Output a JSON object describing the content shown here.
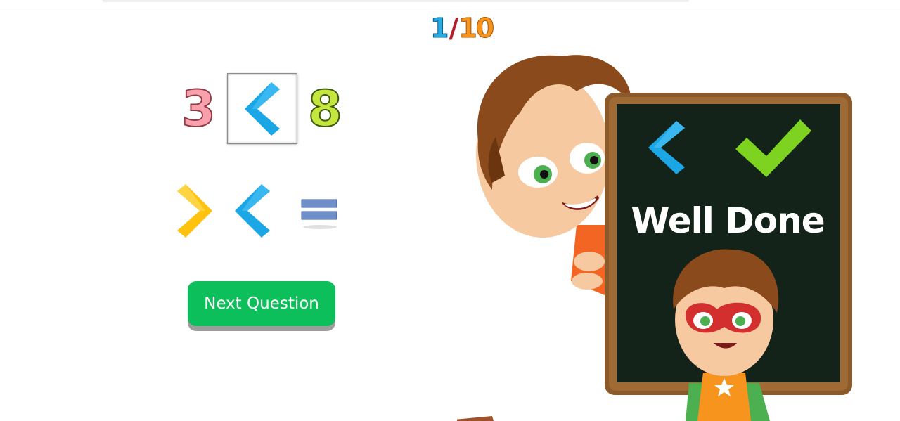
{
  "progress": {
    "current": "1",
    "separator": "/",
    "total": "10"
  },
  "question": {
    "left_number": "3",
    "right_number": "8",
    "placed_symbol": "less-than"
  },
  "choices": [
    {
      "id": "greater-than",
      "color": "#ffc20e"
    },
    {
      "id": "less-than",
      "color": "#1ba6e6"
    },
    {
      "id": "equals",
      "color": "#6f8fc9"
    }
  ],
  "next_button": {
    "label": "Next Question",
    "color": "#0cbf5a"
  },
  "board": {
    "message": "Well Done",
    "symbol": "less-than",
    "result_icon": "check-icon",
    "check_color": "#7ed321"
  },
  "colors": {
    "blue": "#27a9e1",
    "orange": "#f7941d",
    "red": "#b21f2a",
    "board": "#13231a",
    "frame": "#8b5a2b"
  }
}
